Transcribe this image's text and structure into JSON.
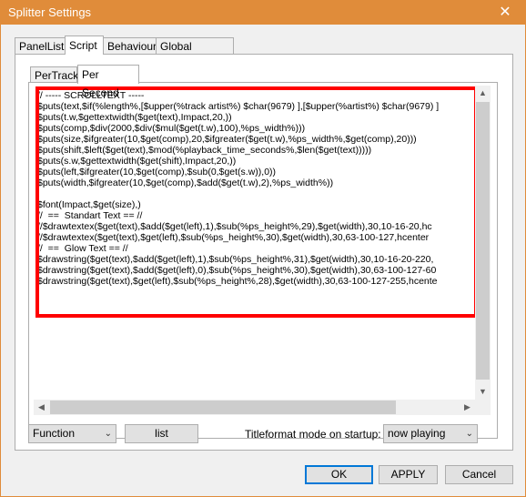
{
  "window": {
    "title": "Splitter Settings",
    "close_glyph": "✕"
  },
  "tabs": {
    "outer": [
      {
        "label": "PanelList",
        "active": false
      },
      {
        "label": "Script",
        "active": true
      },
      {
        "label": "Behaviour",
        "active": false
      },
      {
        "label": "Global variables",
        "active": false
      }
    ],
    "inner": [
      {
        "label": "PerTrack",
        "active": false
      },
      {
        "label": "Per Second",
        "active": true
      }
    ]
  },
  "editor": {
    "lines": [
      "// ----- SCROLLTEXT -----",
      "$puts(text,$if(%length%,[$upper(%track artist%) $char(9679) ],[$upper(%artist%) $char(9679) ]",
      "$puts(t.w,$gettextwidth($get(text),Impact,20,))",
      "$puts(comp,$div(2000,$div($mul($get(t.w),100),%ps_width%)))",
      "$puts(size,$ifgreater(10,$get(comp),20,$ifgreater($get(t.w),%ps_width%,$get(comp),20)))",
      "$puts(shift,$left($get(text),$mod(%playback_time_seconds%,$len($get(text)))))",
      "$puts(s.w,$gettextwidth($get(shift),Impact,20,))",
      "$puts(left,$ifgreater(10,$get(comp),$sub(0,$get(s.w)),0))",
      "$puts(width,$ifgreater(10,$get(comp),$add($get(t.w),2),%ps_width%))",
      "",
      "$font(Impact,$get(size),)",
      "//  ==  Standart Text == //",
      "//$drawtextex($get(text),$add($get(left),1),$sub(%ps_height%,29),$get(width),30,10-16-20,hc",
      "//$drawtextex($get(text),$get(left),$sub(%ps_height%,30),$get(width),30,63-100-127,hcenter",
      "//  ==  Glow Text == //",
      "$drawstring($get(text),$add($get(left),1),$sub(%ps_height%,31),$get(width),30,10-16-20-220,",
      "$drawstring($get(text),$add($get(left),0),$sub(%ps_height%,30),$get(width),30,63-100-127-60",
      "$drawstring($get(text),$get(left),$sub(%ps_height%,28),$get(width),30,63-100-127-255,hcente"
    ]
  },
  "bottom": {
    "function_select": "Function",
    "list_button": "list",
    "titleformat_label": "Titleformat mode on startup:",
    "titleformat_select": "now playing"
  },
  "dialog_buttons": {
    "ok": "OK",
    "apply": "APPLY",
    "cancel": "Cancel"
  },
  "colors": {
    "titlebar": "#e08c3a",
    "highlight_box": "#ff0000",
    "default_button_border": "#0078d7"
  }
}
